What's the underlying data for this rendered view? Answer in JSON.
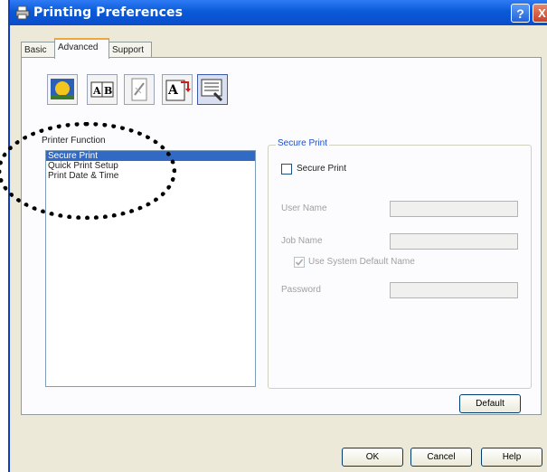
{
  "window": {
    "title": "Printing Preferences",
    "help_label": "?",
    "close_label": "X"
  },
  "tabs": [
    {
      "label": "Basic"
    },
    {
      "label": "Advanced",
      "active": true
    },
    {
      "label": "Support"
    }
  ],
  "toolbar": {
    "icons": [
      "color-icon",
      "scaling-icon",
      "watermark-icon",
      "page-setting-icon",
      "device-options-icon"
    ],
    "letters_1": "A|B",
    "letters_2": "A"
  },
  "printer_function": {
    "label": "Printer Function",
    "items": [
      "Secure Print",
      "Quick Print Setup",
      "Print Date & Time"
    ],
    "selected": "Secure Print"
  },
  "secure_print": {
    "group_title": "Secure Print",
    "checkbox_label": "Secure Print",
    "checked": false,
    "user_name_label": "User Name",
    "user_name_value": "",
    "job_name_label": "Job Name",
    "job_name_value": "",
    "use_default_label": "Use System Default Name",
    "use_default_checked": true,
    "password_label": "Password",
    "password_value": ""
  },
  "buttons": {
    "default": "Default",
    "ok": "OK",
    "cancel": "Cancel",
    "help": "Help"
  },
  "colors": {
    "titlebar": "#0a4ccb",
    "selection": "#316ac5",
    "group_title": "#1e50c8",
    "tab_highlight": "#f0a63c"
  }
}
